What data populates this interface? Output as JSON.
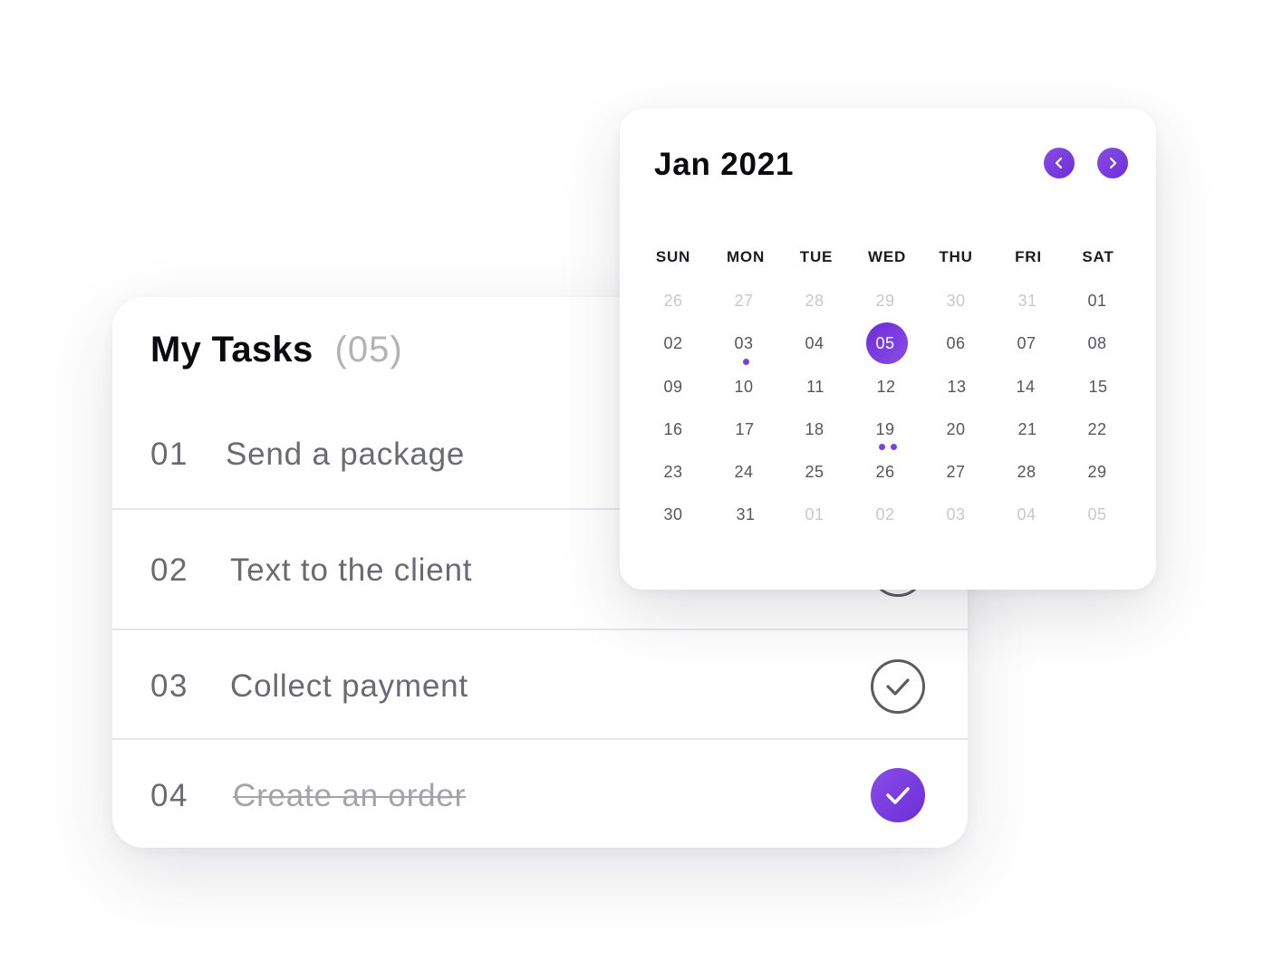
{
  "tasks": {
    "title": "My Tasks",
    "count": "(05)",
    "items": [
      {
        "number": "01",
        "label": "Send a package",
        "done": false
      },
      {
        "number": "02",
        "label": "Text to the client",
        "done": false
      },
      {
        "number": "03",
        "label": "Collect payment",
        "done": false
      },
      {
        "number": "04",
        "label": "Create an order",
        "done": true
      }
    ]
  },
  "calendar": {
    "month_label": "Jan 2021",
    "prev_icon": "chevron-left-icon",
    "next_icon": "chevron-right-icon",
    "weekdays": [
      "SUN",
      "MON",
      "TUE",
      "WED",
      "THU",
      "FRI",
      "SAT"
    ],
    "weeks": [
      [
        "26",
        "27",
        "28",
        "29",
        "30",
        "31",
        "01"
      ],
      [
        "02",
        "03",
        "04",
        "05",
        "06",
        "07",
        "08"
      ],
      [
        "09",
        "10",
        "11",
        "12",
        "13",
        "14",
        "15"
      ],
      [
        "16",
        "17",
        "18",
        "19",
        "20",
        "21",
        "22"
      ],
      [
        "23",
        "24",
        "25",
        "26",
        "27",
        "28",
        "29"
      ],
      [
        "30",
        "31",
        "01",
        "02",
        "03",
        "04",
        "05"
      ]
    ],
    "selected_day": "05",
    "events": {
      "03": 1,
      "19": 2
    }
  },
  "colors": {
    "accent": "#7b3fdf",
    "accent_dark": "#6a2ed8",
    "text_primary": "#0b0b0f",
    "text_secondary": "#6a6a72",
    "text_muted": "#c8c8cd"
  }
}
